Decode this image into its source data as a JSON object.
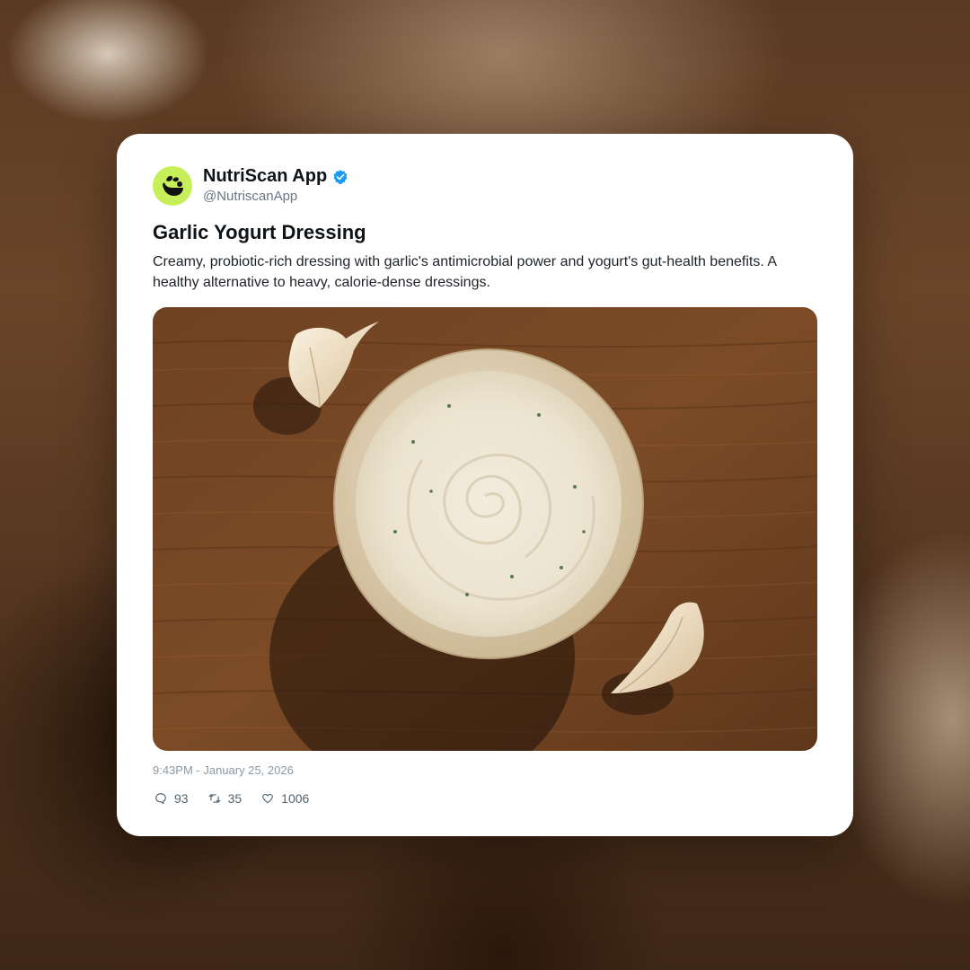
{
  "post": {
    "display_name": "NutriScan App",
    "handle": "@NutriscanApp",
    "title": "Garlic Yogurt Dressing",
    "description": "Creamy, probiotic-rich dressing with garlic's antimicrobial power and yogurt's gut-health benefits. A healthy alternative to heavy, calorie-dense dressings.",
    "timestamp": "9:43PM - January 25, 2026",
    "stats": {
      "replies": "93",
      "retweets": "35",
      "likes": "1006"
    }
  },
  "icons": {
    "avatar": "nutriscan-logo-icon",
    "verified": "verified-badge-icon",
    "reply": "comment-icon",
    "retweet": "retweet-icon",
    "like": "heart-icon"
  },
  "colors": {
    "avatar_bg": "#c6ef5a",
    "verified": "#1d9bf0",
    "text_primary": "#0f1419",
    "text_secondary": "#687684"
  }
}
